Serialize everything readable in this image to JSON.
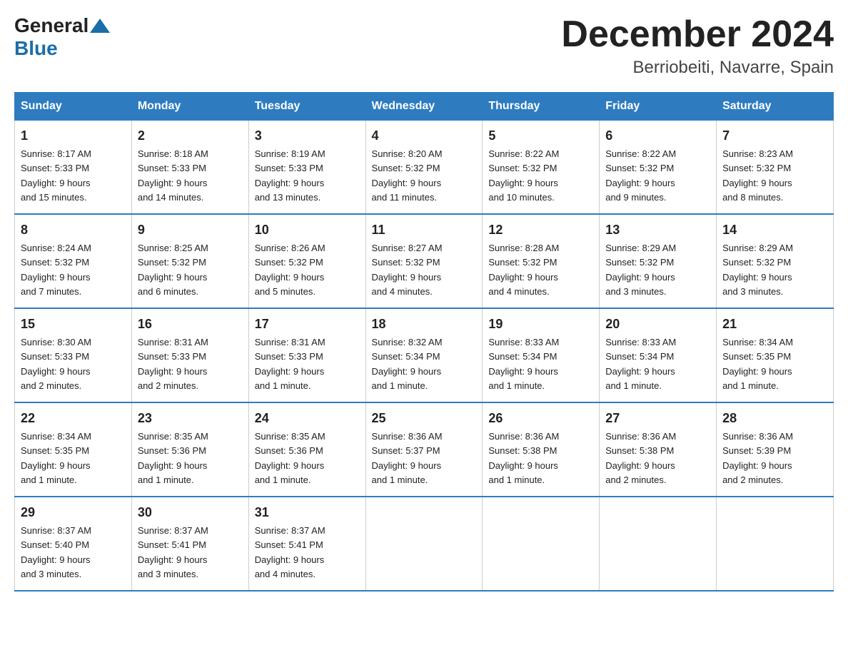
{
  "logo": {
    "general": "General",
    "blue": "Blue"
  },
  "title": "December 2024",
  "subtitle": "Berriobeiti, Navarre, Spain",
  "days_of_week": [
    "Sunday",
    "Monday",
    "Tuesday",
    "Wednesday",
    "Thursday",
    "Friday",
    "Saturday"
  ],
  "weeks": [
    [
      {
        "day": "1",
        "sunrise": "8:17 AM",
        "sunset": "5:33 PM",
        "daylight": "9 hours and 15 minutes."
      },
      {
        "day": "2",
        "sunrise": "8:18 AM",
        "sunset": "5:33 PM",
        "daylight": "9 hours and 14 minutes."
      },
      {
        "day": "3",
        "sunrise": "8:19 AM",
        "sunset": "5:33 PM",
        "daylight": "9 hours and 13 minutes."
      },
      {
        "day": "4",
        "sunrise": "8:20 AM",
        "sunset": "5:32 PM",
        "daylight": "9 hours and 11 minutes."
      },
      {
        "day": "5",
        "sunrise": "8:22 AM",
        "sunset": "5:32 PM",
        "daylight": "9 hours and 10 minutes."
      },
      {
        "day": "6",
        "sunrise": "8:22 AM",
        "sunset": "5:32 PM",
        "daylight": "9 hours and 9 minutes."
      },
      {
        "day": "7",
        "sunrise": "8:23 AM",
        "sunset": "5:32 PM",
        "daylight": "9 hours and 8 minutes."
      }
    ],
    [
      {
        "day": "8",
        "sunrise": "8:24 AM",
        "sunset": "5:32 PM",
        "daylight": "9 hours and 7 minutes."
      },
      {
        "day": "9",
        "sunrise": "8:25 AM",
        "sunset": "5:32 PM",
        "daylight": "9 hours and 6 minutes."
      },
      {
        "day": "10",
        "sunrise": "8:26 AM",
        "sunset": "5:32 PM",
        "daylight": "9 hours and 5 minutes."
      },
      {
        "day": "11",
        "sunrise": "8:27 AM",
        "sunset": "5:32 PM",
        "daylight": "9 hours and 4 minutes."
      },
      {
        "day": "12",
        "sunrise": "8:28 AM",
        "sunset": "5:32 PM",
        "daylight": "9 hours and 4 minutes."
      },
      {
        "day": "13",
        "sunrise": "8:29 AM",
        "sunset": "5:32 PM",
        "daylight": "9 hours and 3 minutes."
      },
      {
        "day": "14",
        "sunrise": "8:29 AM",
        "sunset": "5:32 PM",
        "daylight": "9 hours and 3 minutes."
      }
    ],
    [
      {
        "day": "15",
        "sunrise": "8:30 AM",
        "sunset": "5:33 PM",
        "daylight": "9 hours and 2 minutes."
      },
      {
        "day": "16",
        "sunrise": "8:31 AM",
        "sunset": "5:33 PM",
        "daylight": "9 hours and 2 minutes."
      },
      {
        "day": "17",
        "sunrise": "8:31 AM",
        "sunset": "5:33 PM",
        "daylight": "9 hours and 1 minute."
      },
      {
        "day": "18",
        "sunrise": "8:32 AM",
        "sunset": "5:34 PM",
        "daylight": "9 hours and 1 minute."
      },
      {
        "day": "19",
        "sunrise": "8:33 AM",
        "sunset": "5:34 PM",
        "daylight": "9 hours and 1 minute."
      },
      {
        "day": "20",
        "sunrise": "8:33 AM",
        "sunset": "5:34 PM",
        "daylight": "9 hours and 1 minute."
      },
      {
        "day": "21",
        "sunrise": "8:34 AM",
        "sunset": "5:35 PM",
        "daylight": "9 hours and 1 minute."
      }
    ],
    [
      {
        "day": "22",
        "sunrise": "8:34 AM",
        "sunset": "5:35 PM",
        "daylight": "9 hours and 1 minute."
      },
      {
        "day": "23",
        "sunrise": "8:35 AM",
        "sunset": "5:36 PM",
        "daylight": "9 hours and 1 minute."
      },
      {
        "day": "24",
        "sunrise": "8:35 AM",
        "sunset": "5:36 PM",
        "daylight": "9 hours and 1 minute."
      },
      {
        "day": "25",
        "sunrise": "8:36 AM",
        "sunset": "5:37 PM",
        "daylight": "9 hours and 1 minute."
      },
      {
        "day": "26",
        "sunrise": "8:36 AM",
        "sunset": "5:38 PM",
        "daylight": "9 hours and 1 minute."
      },
      {
        "day": "27",
        "sunrise": "8:36 AM",
        "sunset": "5:38 PM",
        "daylight": "9 hours and 2 minutes."
      },
      {
        "day": "28",
        "sunrise": "8:36 AM",
        "sunset": "5:39 PM",
        "daylight": "9 hours and 2 minutes."
      }
    ],
    [
      {
        "day": "29",
        "sunrise": "8:37 AM",
        "sunset": "5:40 PM",
        "daylight": "9 hours and 3 minutes."
      },
      {
        "day": "30",
        "sunrise": "8:37 AM",
        "sunset": "5:41 PM",
        "daylight": "9 hours and 3 minutes."
      },
      {
        "day": "31",
        "sunrise": "8:37 AM",
        "sunset": "5:41 PM",
        "daylight": "9 hours and 4 minutes."
      },
      null,
      null,
      null,
      null
    ]
  ],
  "labels": {
    "sunrise": "Sunrise:",
    "sunset": "Sunset:",
    "daylight": "Daylight:"
  }
}
